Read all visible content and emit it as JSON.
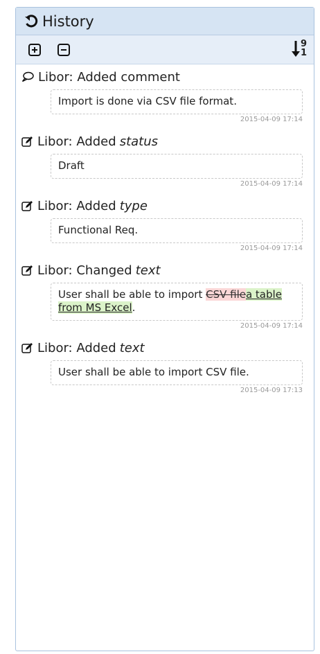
{
  "header": {
    "title": "History",
    "icon": "undo-icon"
  },
  "toolbar": {
    "expand_icon": "plus-square-icon",
    "collapse_icon": "minus-square-icon",
    "sort_icon": "sort-down-icon",
    "sort_top": "9",
    "sort_bottom": "1"
  },
  "entries": [
    {
      "icon": "comment-icon",
      "prefix": "Libor: Added comment",
      "field": "",
      "content": "Import is done via CSV file format.",
      "timestamp": "2015-04-09 17:14"
    },
    {
      "icon": "edit-icon",
      "prefix": "Libor: Added",
      "field": "status",
      "content": "Draft",
      "timestamp": "2015-04-09 17:14"
    },
    {
      "icon": "edit-icon",
      "prefix": "Libor: Added",
      "field": "type",
      "content": "Functional Req.",
      "timestamp": "2015-04-09 17:14"
    },
    {
      "icon": "edit-icon",
      "prefix": "Libor: Changed",
      "field": "text",
      "diff": {
        "before": "User shall be able to import ",
        "deleted": "CSV file",
        "inserted": "a table from MS Excel",
        "after": "."
      },
      "timestamp": "2015-04-09 17:14"
    },
    {
      "icon": "edit-icon",
      "prefix": "Libor: Added",
      "field": "text",
      "content": "User shall be able to import CSV file.",
      "timestamp": "2015-04-09 17:13"
    }
  ],
  "colors": {
    "header_bg": "#d6e4f3",
    "toolbar_bg": "#e6eef8",
    "deleted_bg": "#fbd7d7",
    "inserted_bg": "#dbf3c9"
  }
}
